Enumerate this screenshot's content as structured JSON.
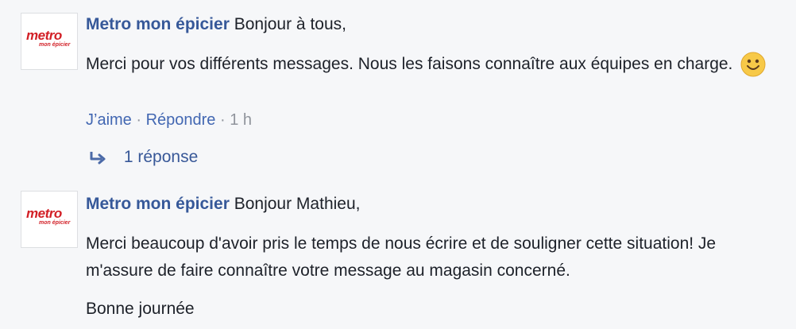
{
  "comments": [
    {
      "avatar": {
        "logo_main": "metro",
        "logo_sub": "mon épicier"
      },
      "author": "Metro mon épicier",
      "greeting": "Bonjour à tous,",
      "paragraph": "Merci pour vos différents messages. Nous les faisons connaître aux équipes en charge.",
      "emoji": "smiley-icon",
      "actions": {
        "like": "J’aime",
        "separator1": " · ",
        "reply": "Répondre",
        "separator2": " · ",
        "time": "1 h"
      },
      "replies_label": "1 réponse"
    },
    {
      "avatar": {
        "logo_main": "metro",
        "logo_sub": "mon épicier"
      },
      "author": "Metro mon épicier",
      "greeting": "Bonjour Mathieu,",
      "paragraph": "Merci beaucoup d'avoir pris le temps de nous écrire et de souligner cette situation! Je m'assure de faire connaître votre message au magasin concerné.",
      "closing": "Bonne journée"
    }
  ],
  "colors": {
    "author": "#365899",
    "link": "#4267b2",
    "brand_red": "#d21f26",
    "meta": "#90949c",
    "background": "#f6f7f9"
  }
}
